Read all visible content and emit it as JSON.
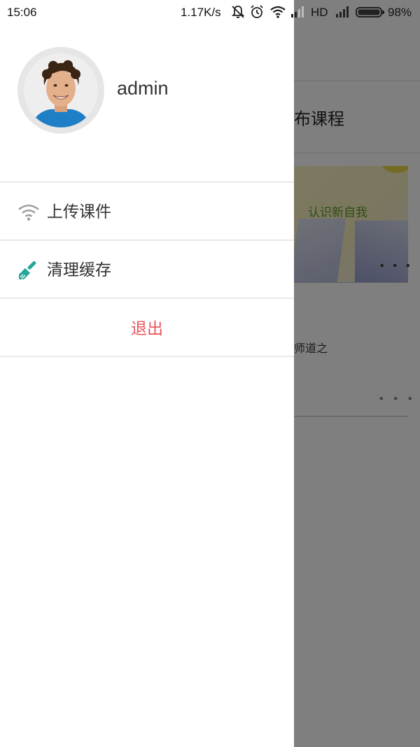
{
  "status_bar": {
    "time": "15:06",
    "network_speed": "1.17K/s",
    "network_type": "HD",
    "battery_percent": "98%",
    "icons": [
      "mute-icon",
      "alarm-icon",
      "wifi-icon",
      "signal-icon",
      "signal-icon",
      "battery-icon"
    ]
  },
  "drawer": {
    "username": "admin",
    "avatar_icon": "user-avatar",
    "menu": [
      {
        "label": "上传课件",
        "icon": "wifi-icon",
        "icon_color": "#9e9e9e"
      },
      {
        "label": "清理缓存",
        "icon": "brush-icon",
        "icon_color": "#26a69a"
      }
    ],
    "logout_label": "退出",
    "logout_color": "#e8535c"
  },
  "background_page": {
    "section_title": "布课程",
    "card": {
      "image_text": "认识新自我",
      "description": "师道之"
    }
  }
}
